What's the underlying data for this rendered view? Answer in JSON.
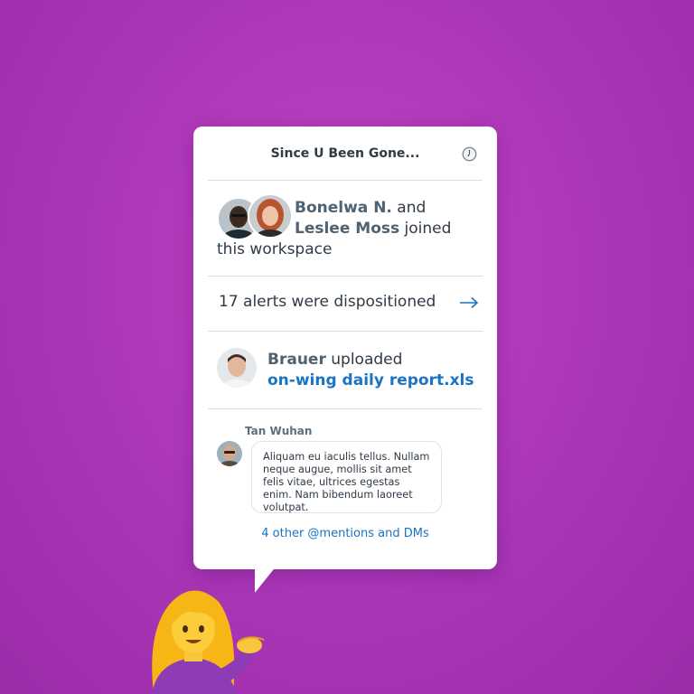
{
  "header": {
    "title": "Since U Been Gone..."
  },
  "joined": {
    "name1": "Bonelwa N.",
    "and": "and",
    "name2": "Leslee Moss",
    "joined_word": "joined",
    "rest": "this workspace"
  },
  "alerts": {
    "text": "17 alerts were dispositioned"
  },
  "upload": {
    "name": "Brauer",
    "verb": "uploaded",
    "file": "on-wing daily report.xls"
  },
  "message": {
    "sender": "Tan Wuhan",
    "body": "Aliquam eu iaculis tellus. Nullam neque augue, mollis sit amet felis vitae, ultrices egestas enim. Nam bibendum laoreet volutpat."
  },
  "mentions": {
    "label": "4 other @mentions and DMs"
  },
  "icons": {
    "clock": "clock-icon",
    "arrow": "arrow-right-icon",
    "emoji": "woman-tipping-hand-emoji"
  },
  "colors": {
    "background": "#b03cbc",
    "link": "#1a73c4",
    "name": "#4f6272",
    "text": "#2f3a45"
  }
}
